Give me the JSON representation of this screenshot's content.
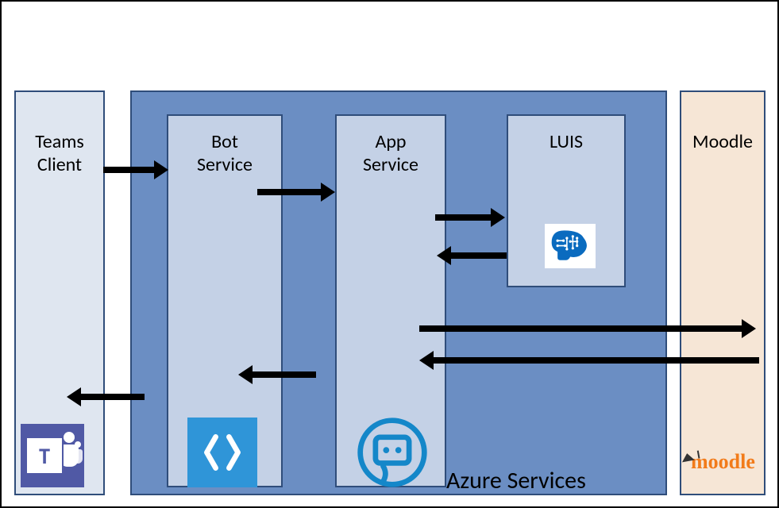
{
  "diagram": {
    "columns": {
      "teams": {
        "title_line1": "Teams",
        "title_line2": "Client"
      },
      "azure": {
        "title": "Azure Services"
      },
      "bot": {
        "title_line1": "Bot",
        "title_line2": "Service"
      },
      "app": {
        "title_line1": "App",
        "title_line2": "Service"
      },
      "luis": {
        "title": "LUIS"
      },
      "moodle": {
        "title": "Moodle",
        "logo_text": "moodle"
      }
    },
    "icons": {
      "teams": "microsoft-teams-icon",
      "bot": "azure-bot-service-icon",
      "app": "azure-cognitive-app-icon",
      "luis": "luis-brain-icon",
      "moodle": "moodle-logo"
    },
    "arrows": [
      {
        "id": "teams-to-bot",
        "from": "teams",
        "to": "bot",
        "dir": "right"
      },
      {
        "id": "bot-to-app",
        "from": "bot",
        "to": "app",
        "dir": "right"
      },
      {
        "id": "app-to-luis",
        "from": "app",
        "to": "luis",
        "dir": "right"
      },
      {
        "id": "luis-to-app",
        "from": "luis",
        "to": "app",
        "dir": "left"
      },
      {
        "id": "app-to-moodle",
        "from": "app",
        "to": "moodle",
        "dir": "right"
      },
      {
        "id": "moodle-to-app",
        "from": "moodle",
        "to": "app",
        "dir": "left"
      },
      {
        "id": "app-to-bot",
        "from": "app",
        "to": "bot",
        "dir": "left"
      },
      {
        "id": "bot-to-teams",
        "from": "bot",
        "to": "teams",
        "dir": "left"
      }
    ],
    "colors": {
      "outer_border": "#000000",
      "azure_bg": "#6b8ec3",
      "inner_bg": "#c4d1e6",
      "teams_bg": "#dfe6f0",
      "moodle_bg": "#f6e6d6",
      "box_border": "#2f4d7a",
      "moodle_orange": "#f27b1a",
      "teams_purple": "#5059a5",
      "azure_blue": "#2f95d8"
    }
  }
}
